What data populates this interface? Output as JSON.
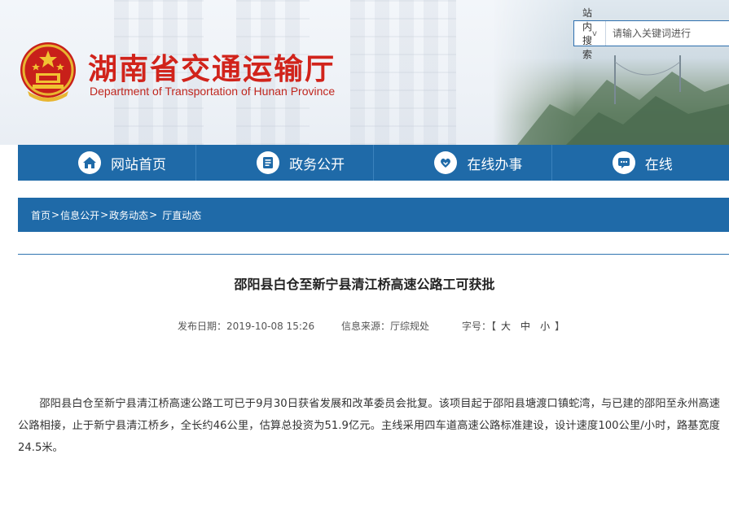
{
  "header": {
    "title": "湖南省交通运输厅",
    "subtitle": "Department of Transportation of Hunan Province",
    "colors": {
      "title_red": "#d1231b",
      "nav_blue": "#1f6aa8"
    }
  },
  "search": {
    "scope_label": "站内搜索",
    "scope_icon": "chevron-down-icon",
    "placeholder": "请输入关键词进行"
  },
  "nav": {
    "items": [
      {
        "label": "网站首页",
        "icon": "home-icon"
      },
      {
        "label": "政务公开",
        "icon": "document-list-icon"
      },
      {
        "label": "在线办事",
        "icon": "heart-hands-icon"
      },
      {
        "label": "在线",
        "icon": "chat-bubble-icon"
      }
    ]
  },
  "breadcrumb": {
    "items": [
      "首页",
      "信息公开",
      "政务动态",
      "厅直动态"
    ],
    "separator": ">"
  },
  "article": {
    "title": "邵阳县白仓至新宁县清江桥高速公路工可获批",
    "publish_date": "发布日期：2019-10-08 15:26",
    "source": "信息来源：厅综规处",
    "font_size_label": "字号：",
    "font_size_open": "【",
    "font_size_large": "大",
    "font_size_medium": "中",
    "font_size_small": "小",
    "font_size_close": "】",
    "body": "邵阳县白仓至新宁县清江桥高速公路工可已于9月30日获省发展和改革委员会批复。该项目起于邵阳县塘渡口镇蛇湾，与已建的邵阳至永州高速公路相接，止于新宁县清江桥乡，全长约46公里，估算总投资为51.9亿元。主线采用四车道高速公路标准建设，设计速度100公里/小时，路基宽度24.5米。"
  }
}
